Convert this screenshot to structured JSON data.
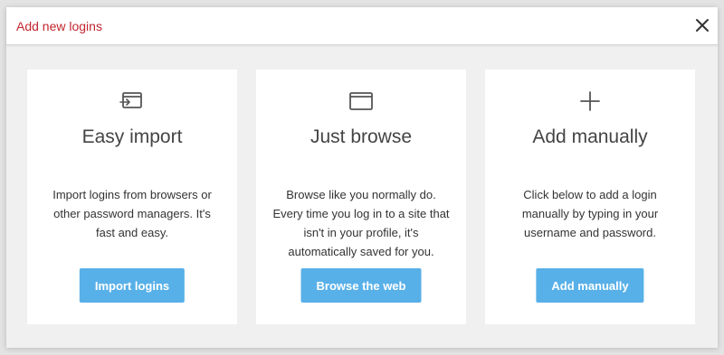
{
  "dialog": {
    "title": "Add new logins",
    "close_icon": "close-icon"
  },
  "colors": {
    "title": "#c2262e",
    "button": "#58b0e8",
    "card": "#ffffff",
    "background": "#f0f0f0"
  },
  "cards": [
    {
      "icon": "import-icon",
      "title": "Easy import",
      "description": "Import logins from browsers or other password managers. It's fast and easy.",
      "button": "Import logins"
    },
    {
      "icon": "browser-window-icon",
      "title": "Just browse",
      "description": "Browse like you normally do. Every time you log in to a site that isn't in your profile, it's automatically saved for you.",
      "button": "Browse the web"
    },
    {
      "icon": "plus-icon",
      "title": "Add manually",
      "description": "Click below to add a login manually by typing in your username and password.",
      "button": "Add manually"
    }
  ]
}
